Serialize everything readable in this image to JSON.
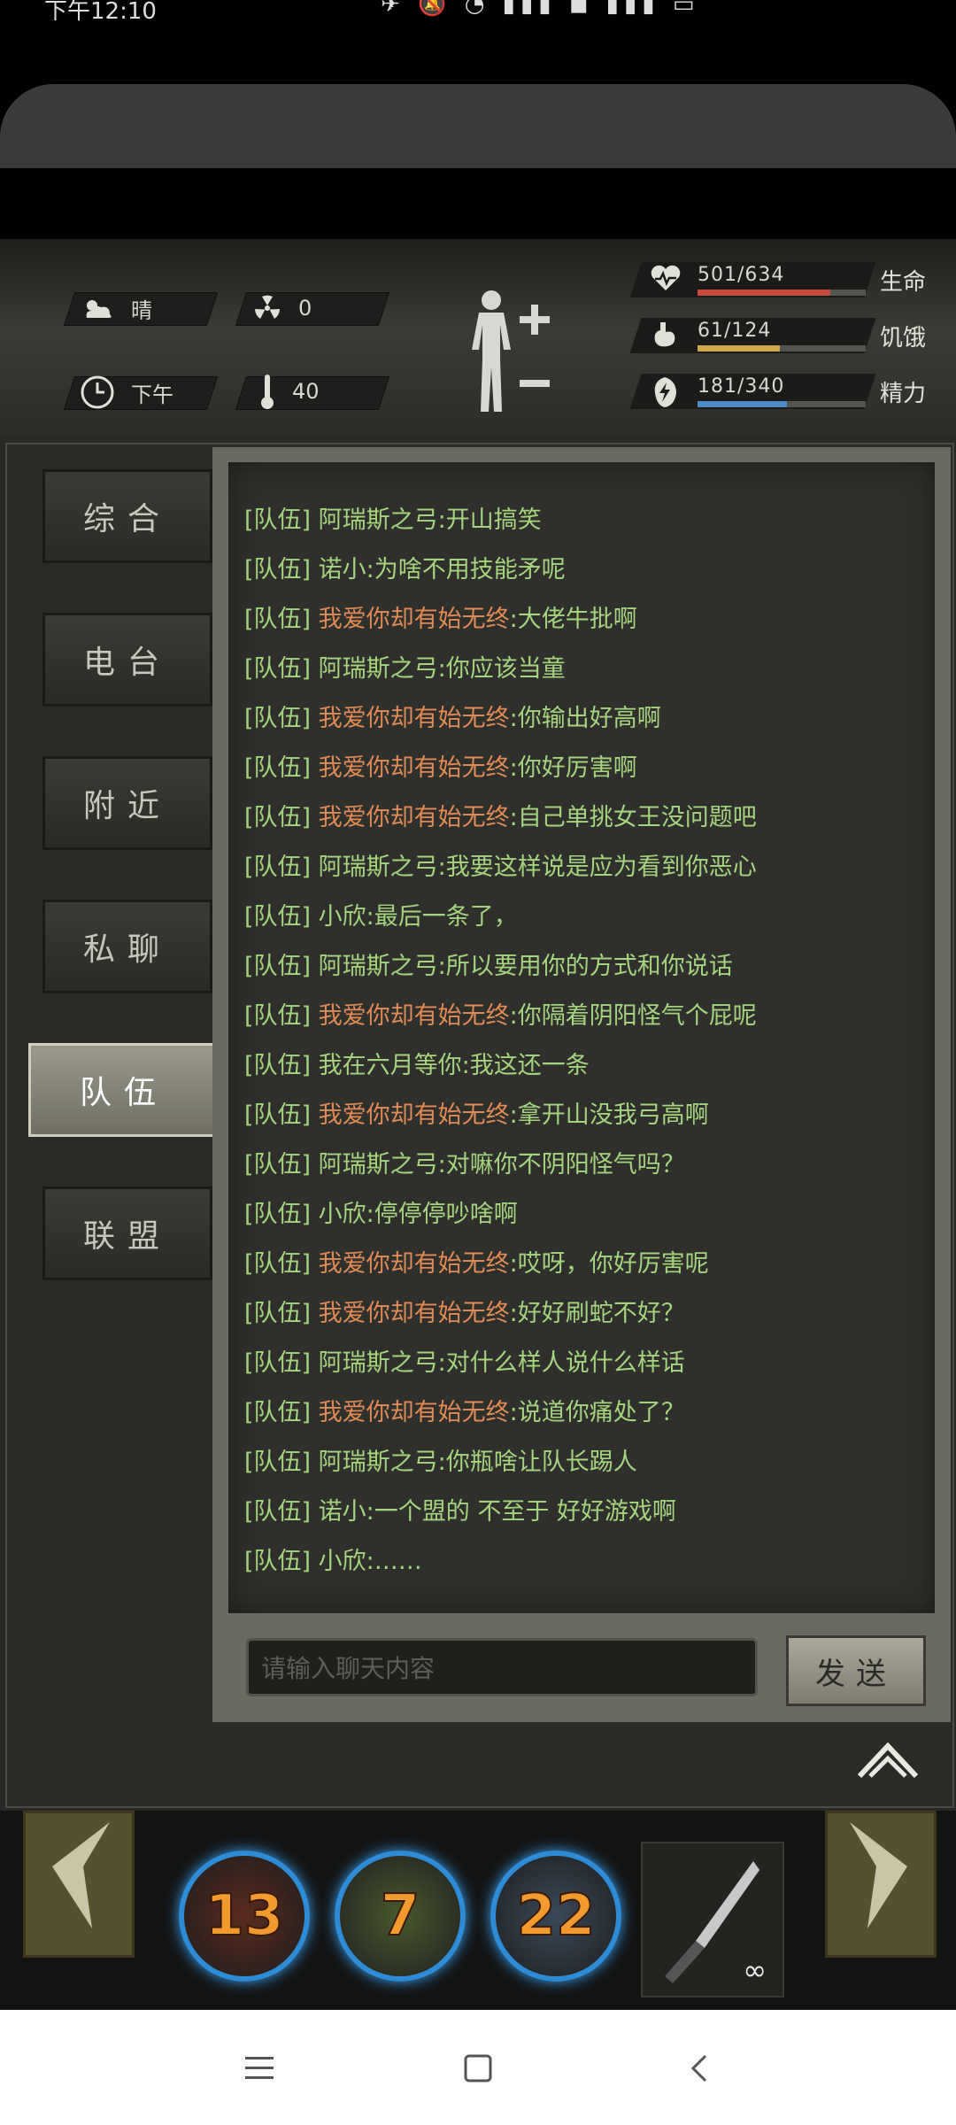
{
  "status_bar": {
    "time": "下午12:10",
    "icons_text": "✈ 🔕 ◔ ▮▮▮ ◼ ▮▮▮ ▭"
  },
  "hud": {
    "weather": "晴",
    "radiation": "0",
    "time_of_day": "下午",
    "temperature": "40",
    "stats": [
      {
        "value": "501/634",
        "label": "生命",
        "fraction": 0.79,
        "color": "#c84a3e",
        "icon": "heart-icon"
      },
      {
        "value": "61/124",
        "label": "饥饿",
        "fraction": 0.49,
        "color": "#d0a84a",
        "icon": "stomach-icon"
      },
      {
        "value": "181/340",
        "label": "精力",
        "fraction": 0.53,
        "color": "#4a8ac8",
        "icon": "energy-icon"
      }
    ]
  },
  "tabs": [
    {
      "label": "综合",
      "active": false
    },
    {
      "label": "电台",
      "active": false
    },
    {
      "label": "附近",
      "active": false
    },
    {
      "label": "私聊",
      "active": false
    },
    {
      "label": "队伍",
      "active": true
    },
    {
      "label": "联盟",
      "active": false
    }
  ],
  "messages": [
    {
      "prefix": "[队伍]",
      "sender": "阿瑞斯之弓",
      "text": ":开山搞笑",
      "highlight": false
    },
    {
      "prefix": "[队伍]",
      "sender": "诺小",
      "text": ":为啥不用技能矛呢",
      "highlight": false
    },
    {
      "prefix": "[队伍]",
      "sender": "我爱你却有始无终",
      "text": ":大佬牛批啊",
      "highlight": true
    },
    {
      "prefix": "[队伍]",
      "sender": "阿瑞斯之弓",
      "text": ":你应该当童",
      "highlight": false
    },
    {
      "prefix": "[队伍]",
      "sender": "我爱你却有始无终",
      "text": ":你输出好高啊",
      "highlight": true
    },
    {
      "prefix": "[队伍]",
      "sender": "我爱你却有始无终",
      "text": ":你好厉害啊",
      "highlight": true
    },
    {
      "prefix": "[队伍]",
      "sender": "我爱你却有始无终",
      "text": ":自己单挑女王没问题吧",
      "highlight": true
    },
    {
      "prefix": "[队伍]",
      "sender": "阿瑞斯之弓",
      "text": ":我要这样说是应为看到你恶心",
      "highlight": false
    },
    {
      "prefix": "[队伍]",
      "sender": "小欣",
      "text": ":最后一条了，",
      "highlight": false
    },
    {
      "prefix": "[队伍]",
      "sender": "阿瑞斯之弓",
      "text": ":所以要用你的方式和你说话",
      "highlight": false
    },
    {
      "prefix": "[队伍]",
      "sender": "我爱你却有始无终",
      "text": ":你隔着阴阳怪气个屁呢",
      "highlight": true
    },
    {
      "prefix": "[队伍]",
      "sender": "我在六月等你",
      "text": ":我这还一条",
      "highlight": false
    },
    {
      "prefix": "[队伍]",
      "sender": "我爱你却有始无终",
      "text": ":拿开山没我弓高啊",
      "highlight": true
    },
    {
      "prefix": "[队伍]",
      "sender": "阿瑞斯之弓",
      "text": ":对嘛你不阴阳怪气吗？",
      "highlight": false
    },
    {
      "prefix": "[队伍]",
      "sender": "小欣",
      "text": ":停停停吵啥啊",
      "highlight": false
    },
    {
      "prefix": "[队伍]",
      "sender": "我爱你却有始无终",
      "text": ":哎呀，你好厉害呢",
      "highlight": true
    },
    {
      "prefix": "[队伍]",
      "sender": "我爱你却有始无终",
      "text": ":好好刷蛇不好？",
      "highlight": true
    },
    {
      "prefix": "[队伍]",
      "sender": "阿瑞斯之弓",
      "text": ":对什么样人说什么样话",
      "highlight": false
    },
    {
      "prefix": "[队伍]",
      "sender": "我爱你却有始无终",
      "text": ":说道你痛处了？",
      "highlight": true
    },
    {
      "prefix": "[队伍]",
      "sender": "阿瑞斯之弓",
      "text": ":你瓶啥让队长踢人",
      "highlight": false
    },
    {
      "prefix": "[队伍]",
      "sender": "诺小",
      "text": ":一个盟的 不至于 好好游戏啊",
      "highlight": false
    },
    {
      "prefix": "[队伍]",
      "sender": "小欣",
      "text": ":……",
      "highlight": false
    }
  ],
  "input": {
    "placeholder": "请输入聊天内容"
  },
  "send_label": "发送",
  "skills": [
    {
      "count": "13",
      "color": "#5a2b1e"
    },
    {
      "count": "7",
      "color": "#4a5a2e"
    },
    {
      "count": "22",
      "color": "#3a4a5a"
    }
  ],
  "weapon": {
    "durability": "∞"
  }
}
